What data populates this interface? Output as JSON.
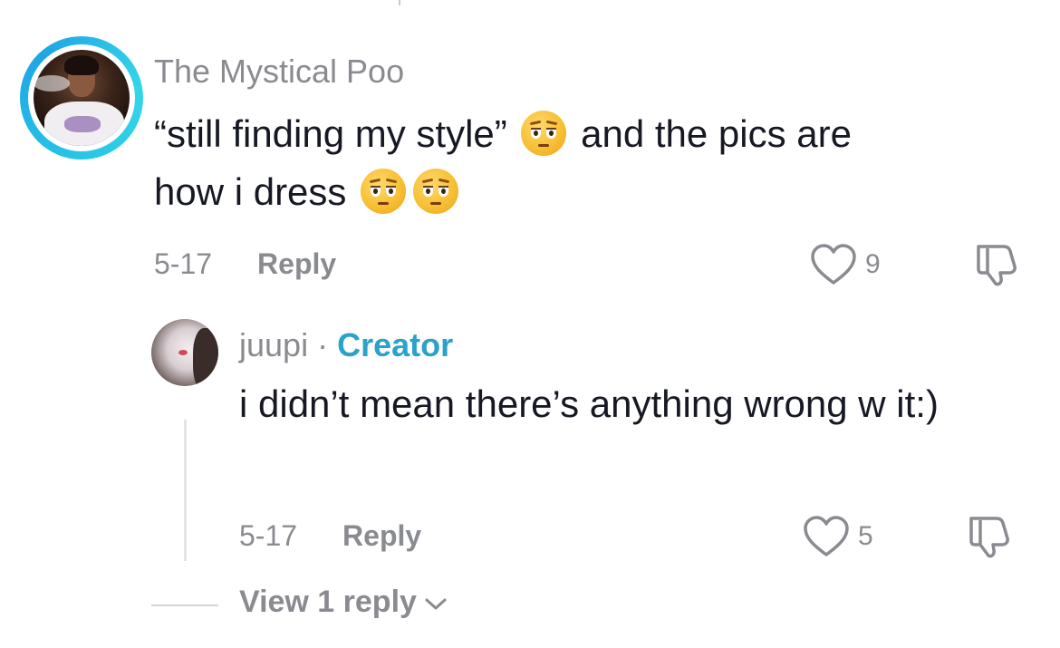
{
  "comment": {
    "username": "The Mystical Poo",
    "text_line1_a": "“still finding my style”",
    "text_line1_b": "and the pics are",
    "text_line2": "how i dress",
    "emoji_name": "pleading-flushed-face",
    "date": "5-17",
    "reply_label": "Reply",
    "like_count": "9"
  },
  "reply": {
    "username": "juupi",
    "separator": "·",
    "badge": "Creator",
    "text": "i didn’t mean there’s anything wrong w it:)",
    "date": "5-17",
    "reply_label": "Reply",
    "like_count": "5"
  },
  "view_replies": {
    "label": "View 1 reply"
  },
  "colors": {
    "secondary_text": "#8a8b91",
    "creator_badge": "#2aa2c9",
    "avatar_ring": "#25c2e6"
  },
  "icons": [
    "heart-icon",
    "dislike-icon",
    "chevron-down-icon"
  ]
}
